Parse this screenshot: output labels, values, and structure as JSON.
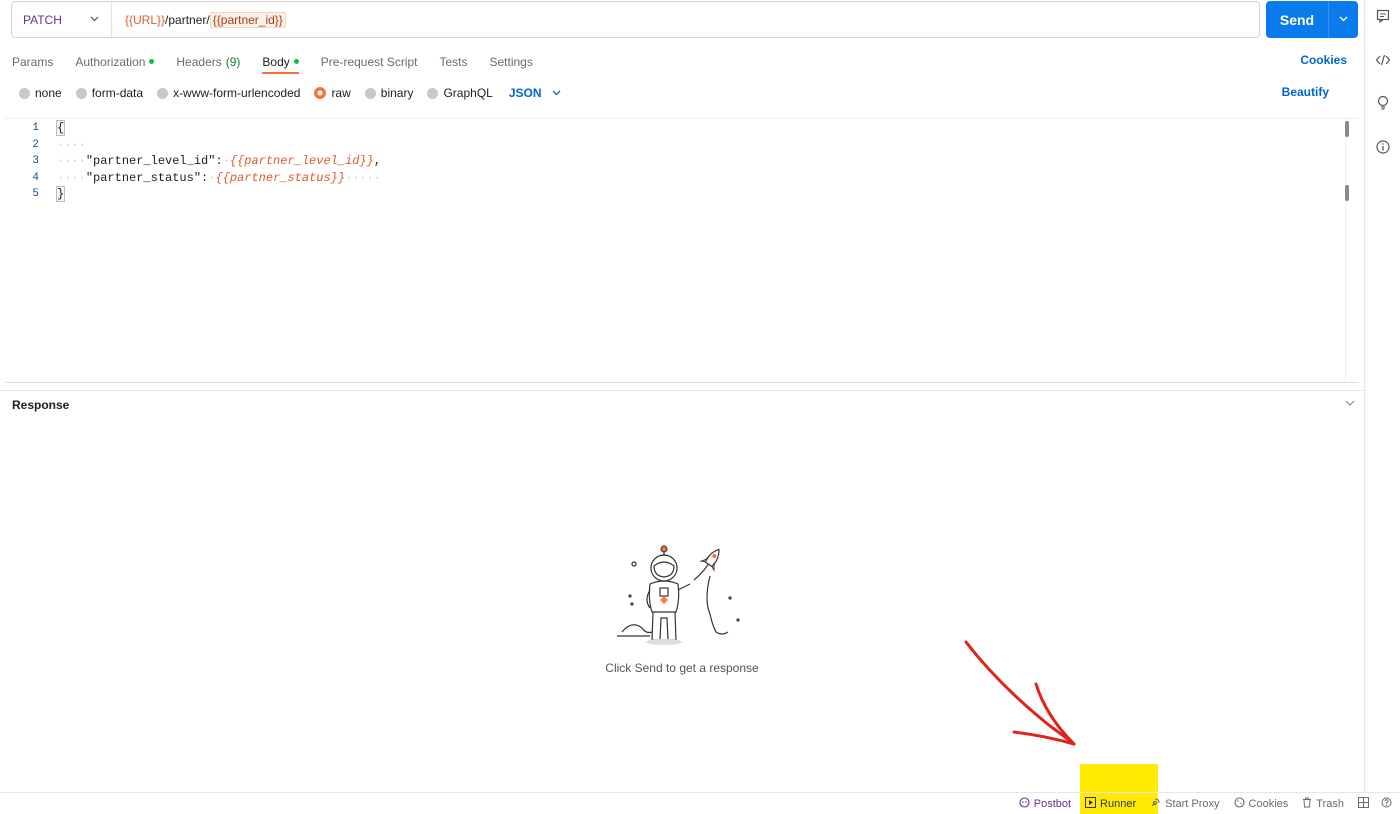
{
  "request": {
    "method": "PATCH",
    "url_parts": {
      "base_var": "{{URL}}",
      "path": "/partner/",
      "id_var": "{{partner_id}}"
    },
    "send_label": "Send"
  },
  "tabs": [
    {
      "label": "Params"
    },
    {
      "label": "Authorization"
    },
    {
      "label": "Headers",
      "count": "(9)"
    },
    {
      "label": "Body"
    },
    {
      "label": "Pre-request Script"
    },
    {
      "label": "Tests"
    },
    {
      "label": "Settings"
    }
  ],
  "cookies_label": "Cookies",
  "body_types": [
    "none",
    "form-data",
    "x-www-form-urlencoded",
    "raw",
    "binary",
    "GraphQL"
  ],
  "body_selected": "raw",
  "language": "JSON",
  "beautify_label": "Beautify",
  "editor": {
    "line_numbers": [
      "1",
      "2",
      "3",
      "4",
      "5"
    ],
    "lines": {
      "l1": "{",
      "l3_key": "\"partner_level_id\"",
      "l3_colon": ":",
      "l3_val": "{{partner_level_id}}",
      "l3_comma": ",",
      "l4_key": "\"partner_status\"",
      "l4_colon": ":",
      "l4_val": "{{partner_status}}",
      "l5": "}"
    }
  },
  "response": {
    "title": "Response",
    "empty_message": "Click Send to get a response"
  },
  "status_bar": {
    "postbot": "Postbot",
    "runner": "Runner",
    "start_proxy": "Start Proxy",
    "cookies": "Cookies",
    "trash": "Trash"
  },
  "colors": {
    "send": "#097bed",
    "accent": "#ff6c37",
    "link": "#0265d2",
    "method": "#623497",
    "annotation_arrow": "#e0241b",
    "annotation_highlight": "#ffea00"
  }
}
